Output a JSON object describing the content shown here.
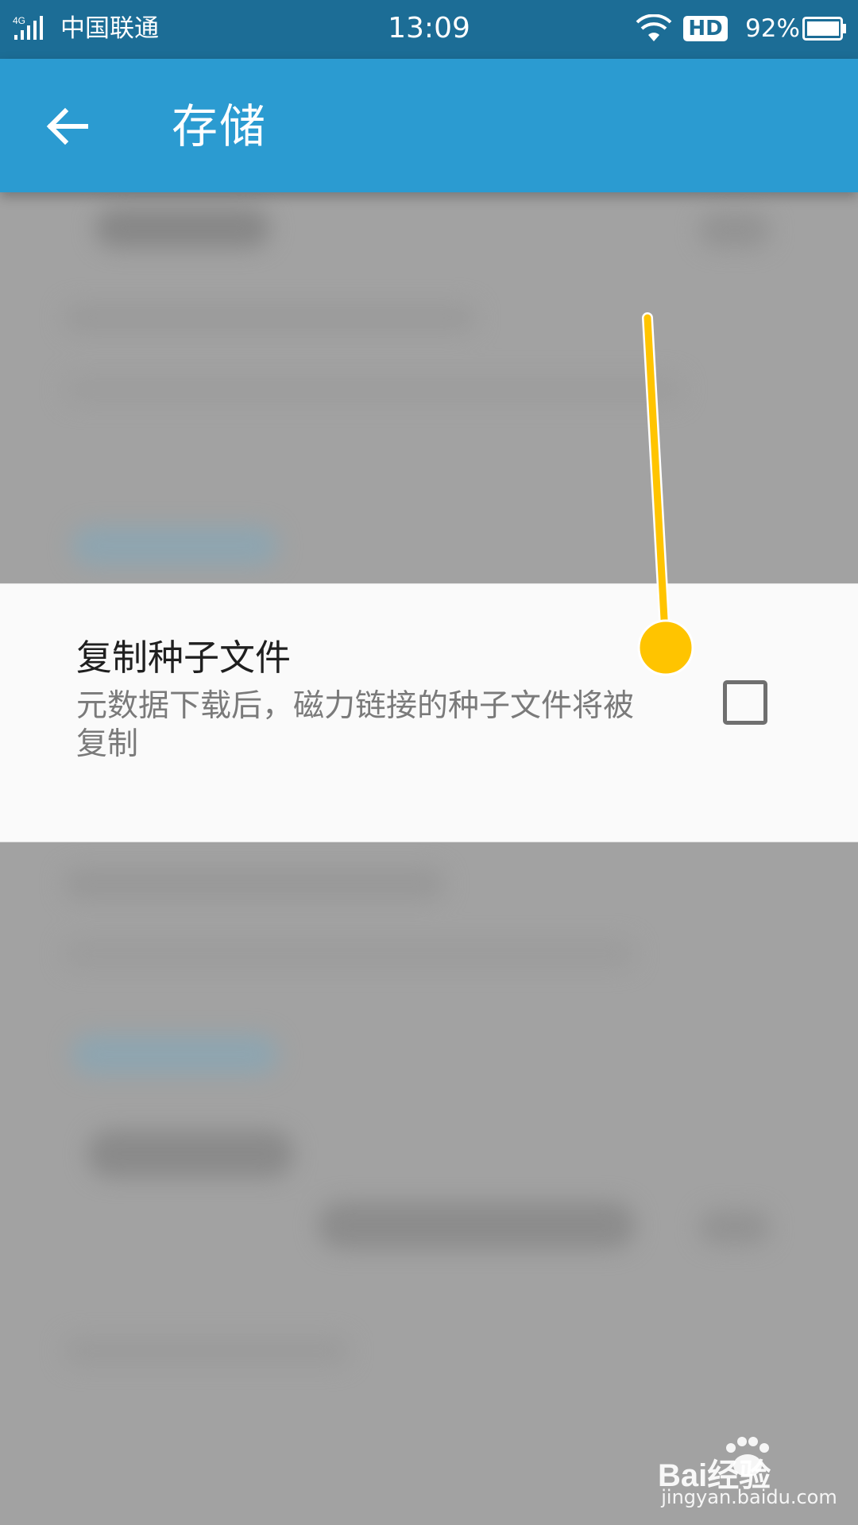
{
  "status_bar": {
    "network_type": "4G",
    "carrier": "中国联通",
    "time": "13:09",
    "hd_label": "HD",
    "battery_percent": "92%"
  },
  "app_bar": {
    "title": "存储",
    "back_icon": "arrow-left-icon"
  },
  "setting": {
    "title": "复制种子文件",
    "summary": "元数据下载后，磁力链接的种子文件将被复制",
    "checked": false
  },
  "watermark": {
    "brand": "Bai经验",
    "url": "jingyan.baidu.com"
  },
  "colors": {
    "status_bar": "#1c6d96",
    "app_bar": "#2b9bd1",
    "annotation": "#ffc400",
    "overlay": "#a2a2a2"
  }
}
